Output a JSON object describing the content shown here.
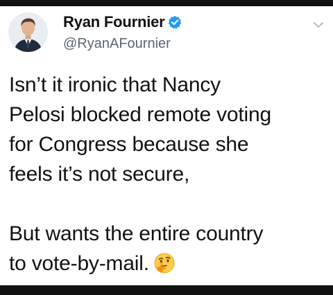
{
  "author": {
    "display_name": "Ryan Fournier",
    "handle": "@RyanAFournier",
    "verified_icon": "verified-badge-icon",
    "avatar_icon": "avatar-photo"
  },
  "menu_icon": "chevron-down-icon",
  "tweet": {
    "paragraph_1": [
      "Isn’t it ironic that Nancy",
      "Pelosi blocked remote voting",
      "for Congress because she",
      "feels it’s not secure,"
    ],
    "paragraph_2": [
      "But wants the entire country",
      "to vote-by-mail."
    ],
    "emoji": "thinking-face-icon"
  },
  "colors": {
    "text": "#111111",
    "handle": "#5b6670",
    "verified": "#1d9bf0",
    "background": "#ffffff",
    "frame": "#111111"
  }
}
